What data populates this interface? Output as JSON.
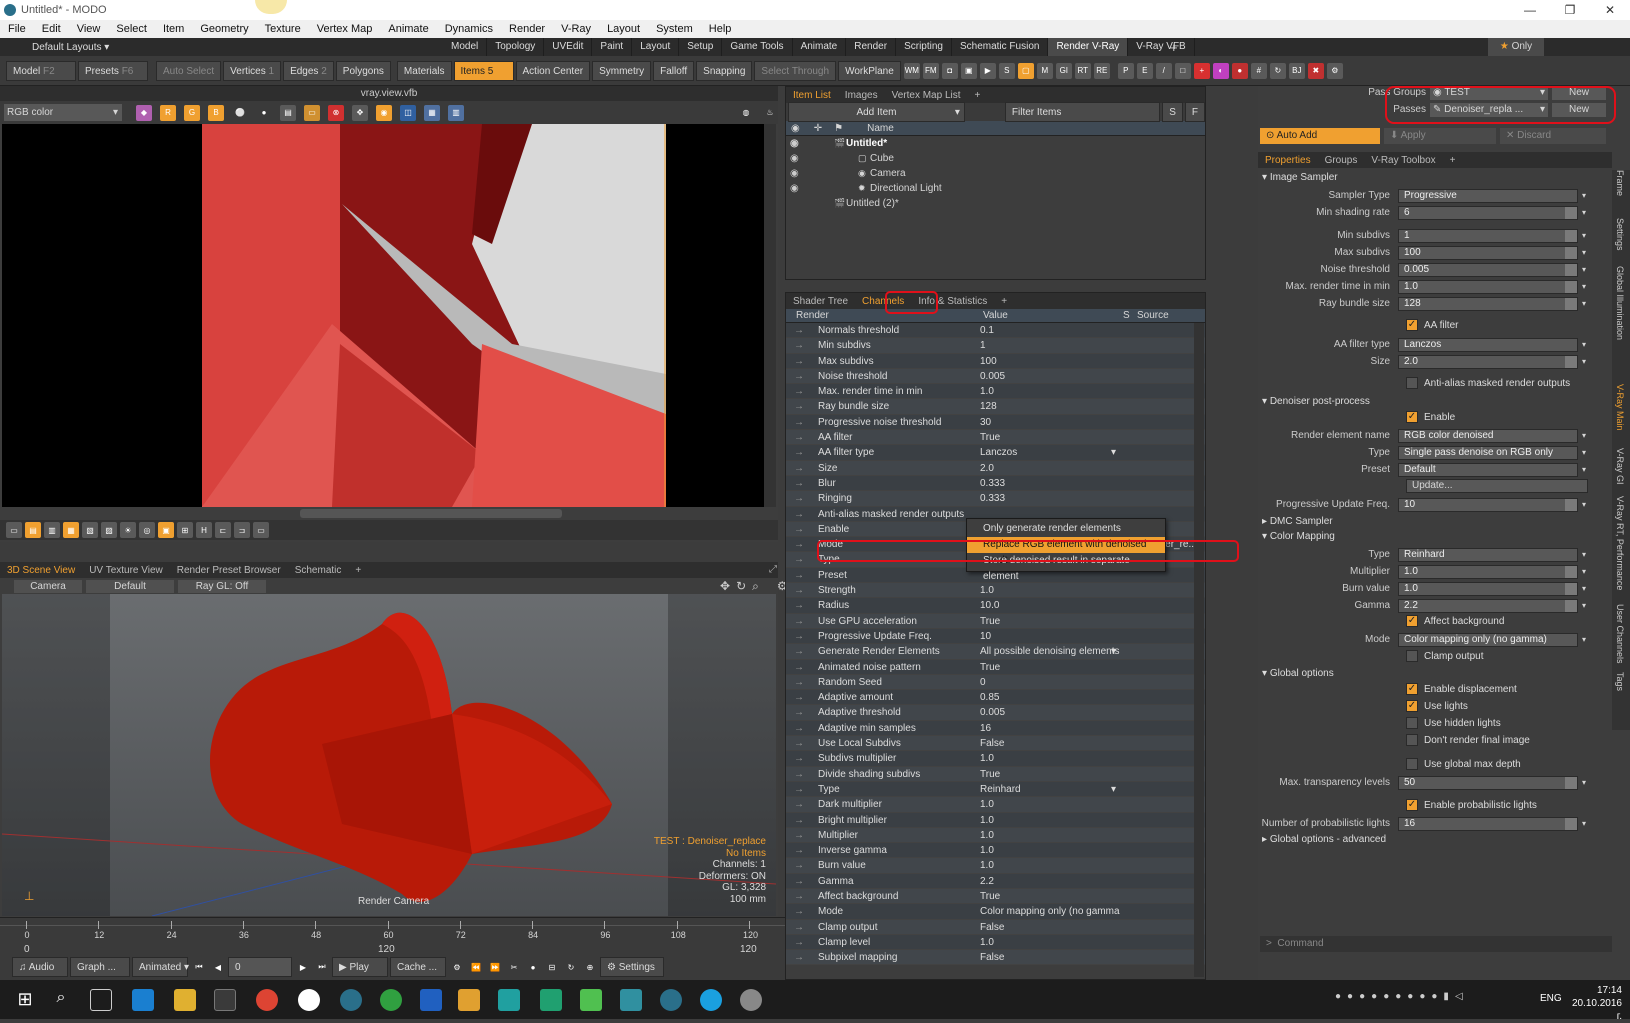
{
  "title": "Untitled* - MODO",
  "menu": [
    "File",
    "Edit",
    "View",
    "Select",
    "Item",
    "Geometry",
    "Texture",
    "Vertex Map",
    "Animate",
    "Dynamics",
    "Render",
    "V-Ray",
    "Layout",
    "System",
    "Help"
  ],
  "layout_label": "Default Layouts",
  "layout_tabs": [
    "Model",
    "Topology",
    "UVEdit",
    "Paint",
    "Layout",
    "Setup",
    "Game Tools",
    "Animate",
    "Render",
    "Scripting",
    "Schematic Fusion",
    "Render V-Ray",
    "V-Ray VFB"
  ],
  "only_label": "Only",
  "toolbar": {
    "model": "Model",
    "model_key": "F2",
    "presets": "Presets",
    "presets_key": "F6",
    "auto_select": "Auto Select",
    "vertices": "Vertices",
    "vertices_key": "1",
    "edges": "Edges",
    "edges_key": "2",
    "polygons": "Polygons",
    "materials": "Materials",
    "items": "Items",
    "items_key": "5",
    "action_center": "Action Center",
    "symmetry": "Symmetry",
    "falloff": "Falloff",
    "snapping": "Snapping",
    "select_through": "Select Through",
    "workplane": "WorkPlane",
    "extra": [
      "WM",
      "FM",
      "M",
      "GI",
      "RT",
      "RE",
      "P",
      "E"
    ]
  },
  "vfb": {
    "title": "vray.view.vfb",
    "channel": "RGB color"
  },
  "viewport3d": {
    "tabs": [
      "3D Scene View",
      "UV Texture View",
      "Render Preset Browser",
      "Schematic"
    ],
    "camera": "Camera",
    "default": "Default",
    "raygl": "Ray GL: Off",
    "pass_info": "TEST : Denoiser_replace",
    "no_items": "No Items",
    "channels": "Channels: 1",
    "deformers": "Deformers: ON",
    "gl": "GL: 3,328",
    "scale": "100 mm",
    "render_camera": "Render Camera"
  },
  "timeline": {
    "ticks": [
      "0",
      "12",
      "24",
      "36",
      "48",
      "60",
      "72",
      "84",
      "96",
      "108",
      "120"
    ],
    "start": "0",
    "end": "120",
    "end_right": "120"
  },
  "bottombar": {
    "audio": "Audio",
    "graph": "Graph ...",
    "animated": "Animated",
    "frame": "0",
    "play": "Play",
    "cache": "Cache ...",
    "settings": "Settings"
  },
  "item_list": {
    "tabs": [
      "Item List",
      "Images",
      "Vertex Map List"
    ],
    "add_item": "Add Item",
    "filter": "Filter Items",
    "filter_s": "S",
    "filter_f": "F",
    "name_header": "Name",
    "items": [
      "Untitled*",
      "Cube",
      "Camera",
      "Directional Light",
      "Untitled (2)*"
    ]
  },
  "channels": {
    "tabs": [
      "Shader Tree",
      "Channels",
      "Info & Statistics"
    ],
    "headers": {
      "render": "Render",
      "value": "Value",
      "s": "S",
      "source": "Source"
    },
    "rows": [
      {
        "name": "Normals threshold",
        "value": "0.1"
      },
      {
        "name": "Min subdivs",
        "value": "1"
      },
      {
        "name": "Max subdivs",
        "value": "100"
      },
      {
        "name": "Noise threshold",
        "value": "0.005"
      },
      {
        "name": "Max. render time in min",
        "value": "1.0"
      },
      {
        "name": "Ray bundle size",
        "value": "128"
      },
      {
        "name": "Progressive noise threshold",
        "value": "30"
      },
      {
        "name": "AA filter",
        "value": "True"
      },
      {
        "name": "AA filter type",
        "value": "Lanczos",
        "dd": "▾"
      },
      {
        "name": "Size",
        "value": "2.0"
      },
      {
        "name": "Blur",
        "value": "0.333"
      },
      {
        "name": "Ringing",
        "value": "0.333"
      },
      {
        "name": "Anti-alias masked render outputs",
        "value": ""
      },
      {
        "name": "Enable",
        "value": "",
        "source": "setup"
      },
      {
        "name": "Mode",
        "value": "",
        "source": "Denoiser_re..."
      },
      {
        "name": "Type",
        "value": "",
        "source": "setup"
      },
      {
        "name": "Preset",
        "value": ""
      },
      {
        "name": "Strength",
        "value": "1.0"
      },
      {
        "name": "Radius",
        "value": "10.0"
      },
      {
        "name": "Use GPU acceleration",
        "value": "True"
      },
      {
        "name": "Progressive Update Freq.",
        "value": "10"
      },
      {
        "name": "Generate Render Elements",
        "value": "All possible denoising elements",
        "dd": "▾"
      },
      {
        "name": "Animated noise pattern",
        "value": "True"
      },
      {
        "name": "Random Seed",
        "value": "0"
      },
      {
        "name": "Adaptive amount",
        "value": "0.85"
      },
      {
        "name": "Adaptive threshold",
        "value": "0.005"
      },
      {
        "name": "Adaptive min samples",
        "value": "16"
      },
      {
        "name": "Use Local Subdivs",
        "value": "False"
      },
      {
        "name": "Subdivs multiplier",
        "value": "1.0"
      },
      {
        "name": "Divide shading subdivs",
        "value": "True"
      },
      {
        "name": "Type",
        "value": "Reinhard",
        "dd": "▾"
      },
      {
        "name": "Dark multiplier",
        "value": "1.0"
      },
      {
        "name": "Bright multiplier",
        "value": "1.0"
      },
      {
        "name": "Multiplier",
        "value": "1.0"
      },
      {
        "name": "Inverse gamma",
        "value": "1.0"
      },
      {
        "name": "Burn value",
        "value": "1.0"
      },
      {
        "name": "Gamma",
        "value": "2.2"
      },
      {
        "name": "Affect background",
        "value": "True"
      },
      {
        "name": "Mode",
        "value": "Color mapping only (no gamma..."
      },
      {
        "name": "Clamp output",
        "value": "False"
      },
      {
        "name": "Clamp level",
        "value": "1.0"
      },
      {
        "name": "Subpixel mapping",
        "value": "False"
      }
    ],
    "popup": [
      "Only generate render elements",
      "Replace RGB element with denoised result",
      "Store denoised result in separate element"
    ]
  },
  "passes": {
    "pass_groups_label": "Pass Groups",
    "pass_groups_value": "TEST",
    "passes_label": "Passes",
    "passes_value": "Denoiser_repla ...",
    "new": "New"
  },
  "actions": {
    "auto_add": "Auto Add",
    "apply": "Apply",
    "discard": "Discard"
  },
  "props_tabs": [
    "Properties",
    "Groups",
    "V-Ray Toolbox"
  ],
  "side_tabs": [
    "Frame",
    "Settings",
    "Global Illumination",
    "V-Ray Main",
    "V-Ray GI",
    "V-Ray RT, Performance",
    "User Channels",
    "Tags"
  ],
  "props": {
    "image_sampler": "Image Sampler",
    "sampler_type": {
      "label": "Sampler Type",
      "value": "Progressive"
    },
    "min_shading_rate": {
      "label": "Min shading rate",
      "value": "6"
    },
    "min_subdivs": {
      "label": "Min subdivs",
      "value": "1"
    },
    "max_subdivs": {
      "label": "Max subdivs",
      "value": "100"
    },
    "noise_threshold": {
      "label": "Noise threshold",
      "value": "0.005"
    },
    "max_render_time": {
      "label": "Max. render time in min",
      "value": "1.0"
    },
    "ray_bundle": {
      "label": "Ray bundle size",
      "value": "128"
    },
    "aa_filter": "AA filter",
    "aa_filter_type": {
      "label": "AA filter type",
      "value": "Lanczos"
    },
    "size": {
      "label": "Size",
      "value": "2.0"
    },
    "anti_alias_masked": "Anti-alias masked render outputs",
    "denoiser": "Denoiser post-process",
    "enable": "Enable",
    "render_element_name": {
      "label": "Render element name",
      "value": "RGB color denoised"
    },
    "type": {
      "label": "Type",
      "value": "Single pass denoise on RGB only"
    },
    "preset": {
      "label": "Preset",
      "value": "Default"
    },
    "update": "Update...",
    "prog_update": {
      "label": "Progressive Update Freq.",
      "value": "10"
    },
    "dmc_sampler": "DMC Sampler",
    "color_mapping": "Color Mapping",
    "cm_type": {
      "label": "Type",
      "value": "Reinhard"
    },
    "multiplier": {
      "label": "Multiplier",
      "value": "1.0"
    },
    "burn": {
      "label": "Burn value",
      "value": "1.0"
    },
    "gamma": {
      "label": "Gamma",
      "value": "2.2"
    },
    "affect_bg": "Affect background",
    "mode": {
      "label": "Mode",
      "value": "Color mapping only (no gamma)"
    },
    "clamp": "Clamp output",
    "global_options": "Global options",
    "enable_disp": "Enable displacement",
    "use_lights": "Use lights",
    "use_hidden": "Use hidden lights",
    "dont_render": "Don't render final image",
    "use_global_max": "Use global max depth",
    "max_transp": {
      "label": "Max. transparency levels",
      "value": "50"
    },
    "enable_prob": "Enable probabilistic lights",
    "num_prob": {
      "label": "Number of probabilistic lights",
      "value": "16"
    },
    "global_adv": "Global options - advanced"
  },
  "command_placeholder": "Command",
  "clock": {
    "time": "17:14",
    "date": "20.10.2016 г.",
    "lang": "ENG"
  }
}
